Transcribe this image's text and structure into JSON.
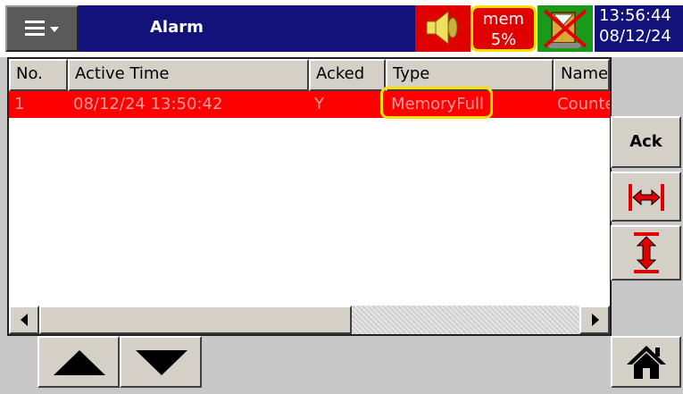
{
  "header": {
    "title": "Alarm",
    "memory": {
      "label": "mem",
      "value": "5%"
    },
    "time": "13:56:44",
    "date": "08/12/24"
  },
  "icons": {
    "menu": "hamburger-menu-icon",
    "speaker": "speaker-icon",
    "status": "mailbox-crossed-icon",
    "hscroll": "horizontal-autosize-icon",
    "vscroll": "vertical-autosize-icon",
    "up": "up-arrow-icon",
    "down": "down-arrow-icon",
    "home": "home-icon"
  },
  "table": {
    "columns": [
      "No.",
      "Active Time",
      "Acked",
      "Type",
      "Name"
    ],
    "rows": [
      {
        "no": "1",
        "active_time": "08/12/24 13:50:42",
        "acked": "Y",
        "type": "MemoryFull",
        "name": "Counte"
      }
    ]
  },
  "side": {
    "ack_label": "Ack"
  },
  "colors": {
    "title_bg": "#12127a",
    "alarm_row": "#ff0000",
    "highlight": "#ffe000",
    "status_bg": "#1a9a1a"
  }
}
